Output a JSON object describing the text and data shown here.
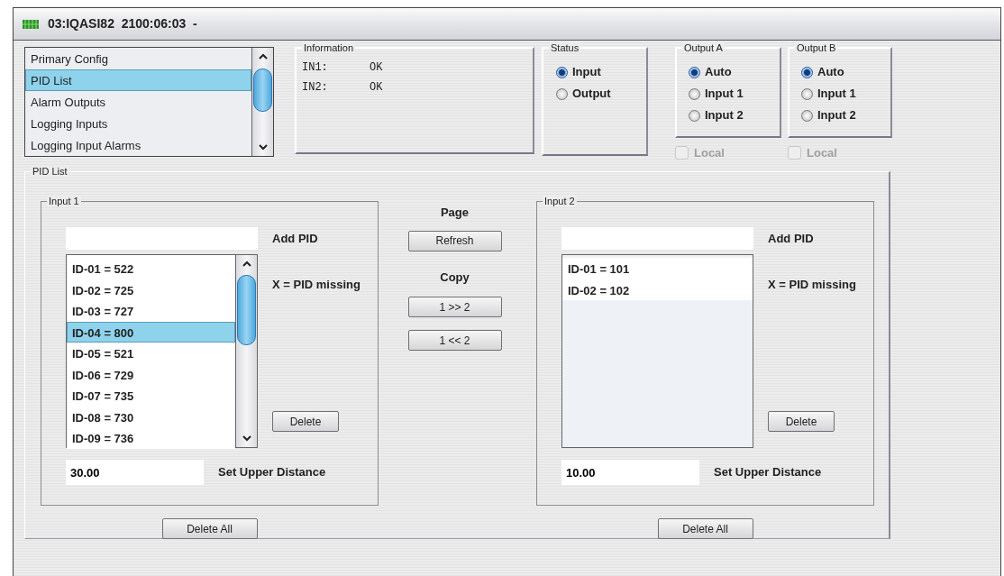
{
  "window": {
    "title": "03:IQASI82  2100:06:03  -"
  },
  "nav": {
    "items": [
      {
        "label": "Primary Config",
        "selected": false
      },
      {
        "label": "PID List",
        "selected": true
      },
      {
        "label": "Alarm Outputs",
        "selected": false
      },
      {
        "label": "Logging Inputs",
        "selected": false
      },
      {
        "label": "Logging Input Alarms",
        "selected": false
      }
    ]
  },
  "information": {
    "title": "Information",
    "rows": [
      {
        "label": "IN1:",
        "value": "OK"
      },
      {
        "label": "IN2:",
        "value": "OK"
      }
    ]
  },
  "status": {
    "title": "Status",
    "options": [
      {
        "label": "Input",
        "selected": true
      },
      {
        "label": "Output",
        "selected": false
      }
    ]
  },
  "outputs": [
    {
      "title": "Output A",
      "options": [
        {
          "label": "Auto",
          "selected": true
        },
        {
          "label": "Input 1",
          "selected": false
        },
        {
          "label": "Input 2",
          "selected": false
        }
      ],
      "local": {
        "label": "Local",
        "checked": false,
        "disabled": true
      }
    },
    {
      "title": "Output B",
      "options": [
        {
          "label": "Auto",
          "selected": true
        },
        {
          "label": "Input 1",
          "selected": false
        },
        {
          "label": "Input 2",
          "selected": false
        }
      ],
      "local": {
        "label": "Local",
        "checked": false,
        "disabled": true
      }
    }
  ],
  "pid_list": {
    "title": "PID List",
    "inputs": [
      {
        "title": "Input 1",
        "add_label": "Add PID",
        "legend": "X = PID missing",
        "delete_button": "Delete",
        "distance_value": "30.00",
        "distance_label": "Set Upper Distance",
        "delete_all_button": "Delete All",
        "entries": [
          {
            "text": "ID-01 = 522",
            "selected": false
          },
          {
            "text": "ID-02 = 725",
            "selected": false
          },
          {
            "text": "ID-03 = 727",
            "selected": false
          },
          {
            "text": "ID-04 = 800",
            "selected": true
          },
          {
            "text": "ID-05 = 521",
            "selected": false
          },
          {
            "text": "ID-06 = 729",
            "selected": false
          },
          {
            "text": "ID-07 = 735",
            "selected": false
          },
          {
            "text": "ID-08 = 730",
            "selected": false
          },
          {
            "text": "ID-09 = 736",
            "selected": false
          }
        ]
      },
      {
        "title": "Input 2",
        "add_label": "Add PID",
        "legend": "X = PID missing",
        "delete_button": "Delete",
        "distance_value": "10.00",
        "distance_label": "Set Upper Distance",
        "delete_all_button": "Delete All",
        "entries": [
          {
            "text": "ID-01 = 101",
            "selected": false
          },
          {
            "text": "ID-02 = 102",
            "selected": false
          }
        ]
      }
    ],
    "page": {
      "title": "Page",
      "refresh_button": "Refresh",
      "copy_title": "Copy",
      "copy_buttons": [
        "1 >> 2",
        "1 << 2"
      ]
    }
  }
}
